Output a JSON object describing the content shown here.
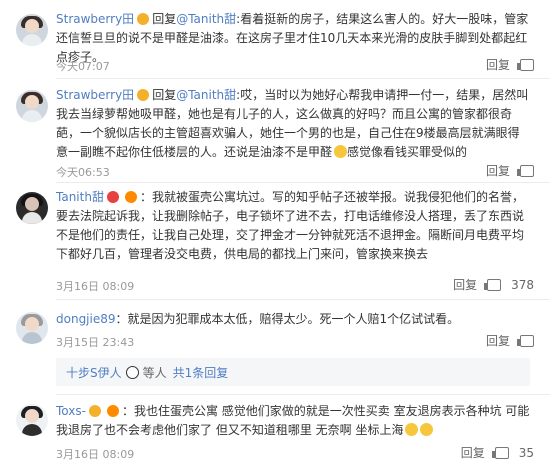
{
  "comments": [
    {
      "name": "Strawberry田",
      "reply_prefix": "回复",
      "reply_to": "@Tanith甜",
      "text": ":看着挺新的房子，结果这么害人的。好大一股味，管家还信誓旦旦的说不是甲醛是油漆。在这房子里才住10几天本来光滑的皮肤手脚到处都起红点疹子。",
      "time": "今天07:07",
      "reply_label": "回复",
      "likes": ""
    },
    {
      "name": "Strawberry田",
      "reply_prefix": "回复",
      "reply_to": "@Tanith甜",
      "text": ":哎，当时以为她好心帮我申请押一付一，结果，居然叫我去当绿萝帮她吸甲醛，她也是有儿子的人，这么做真的好吗？而且公寓的管家都很奇葩，一个貌似店长的主管超喜欢骗人，她住一个男的也是，自己住在9楼最高层就满眼得意一副瞧不起你住低楼层的人。还说是油漆不是甲醛",
      "text_tail": "感觉像看钱买罪受似的",
      "time": "今天06:53",
      "reply_label": "回复",
      "likes": ""
    },
    {
      "name": "Tanith甜",
      "text": "：我就被蛋壳公寓坑过。写的知乎帖子还被举报。说我侵犯他们的名誉，要去法院起诉我，让我删除帖子，电子锁坏了进不去，打电话维修没人搭理，丢了东西说不是他们的责任，让我自己处理，交了押金才一分钟就死活不退押金。隔断间月电费平均下都好几百，管理者没交电费，供电局的都找上门来问，管家换来换去",
      "time": "3月16日 08:09",
      "reply_label": "回复",
      "likes": "378"
    },
    {
      "name": "dongjie89",
      "text": "：就是因为犯罪成本太低，赔得太少。死一个人赔1个亿试试看。",
      "time": "3月15日 23:43",
      "reply_label": "回复",
      "likes": "",
      "subreply": {
        "user": "十步S伊人",
        "mid": "等人",
        "link": "共1条回复"
      }
    },
    {
      "name": "Toxs-",
      "text": "：我也住蛋壳公寓  感觉他们家做的就是一次性买卖 室友退房表示各种坑 可能我退房了也不会考虑他们家了 但又不知道租哪里 无奈啊 坐标上海",
      "time": "3月16日 08:09",
      "reply_label": "回复",
      "likes": "35"
    }
  ],
  "colors": {
    "name": "#4f7ec2",
    "meta": "#999999",
    "text": "#333333"
  }
}
